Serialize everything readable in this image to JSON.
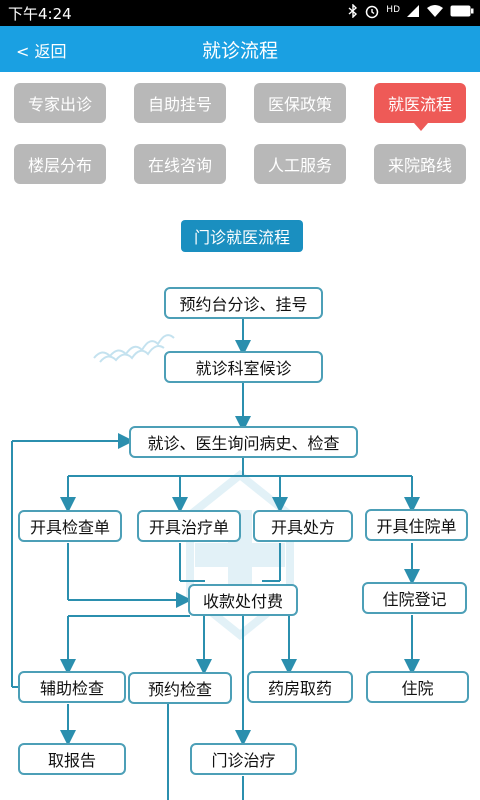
{
  "status": {
    "time": "下午4:24",
    "signal": "HD"
  },
  "header": {
    "back_label": "< 返回",
    "title": "就诊流程"
  },
  "menu": {
    "row1": [
      "专家出诊",
      "自助挂号",
      "医保政策",
      "就医流程"
    ],
    "row2": [
      "楼层分布",
      "在线咨询",
      "人工服务",
      "来院路线"
    ]
  },
  "flow": {
    "title": "门诊就医流程",
    "nodes": {
      "register": "预约台分诊、挂号",
      "wait": "就诊科室候诊",
      "consult": "就诊、医生询问病史、检查",
      "exam_order": "开具检查单",
      "treat_order": "开具治疗单",
      "prescription": "开具处方",
      "admission_order": "开具住院单",
      "payment": "收款处付费",
      "admission_register": "住院登记",
      "aux_exam": "辅助检查",
      "book_exam": "预约检查",
      "pharmacy": "药房取药",
      "hospitalize": "住院",
      "get_report": "取报告",
      "outpatient_treat": "门诊治疗"
    }
  },
  "colors": {
    "accent": "#1aa0e2",
    "active": "#ee5a57",
    "inactive": "#b8b8b8",
    "flow_title": "#1a8fc0",
    "line": "#2b8fae",
    "border": "#4c9fb7"
  }
}
